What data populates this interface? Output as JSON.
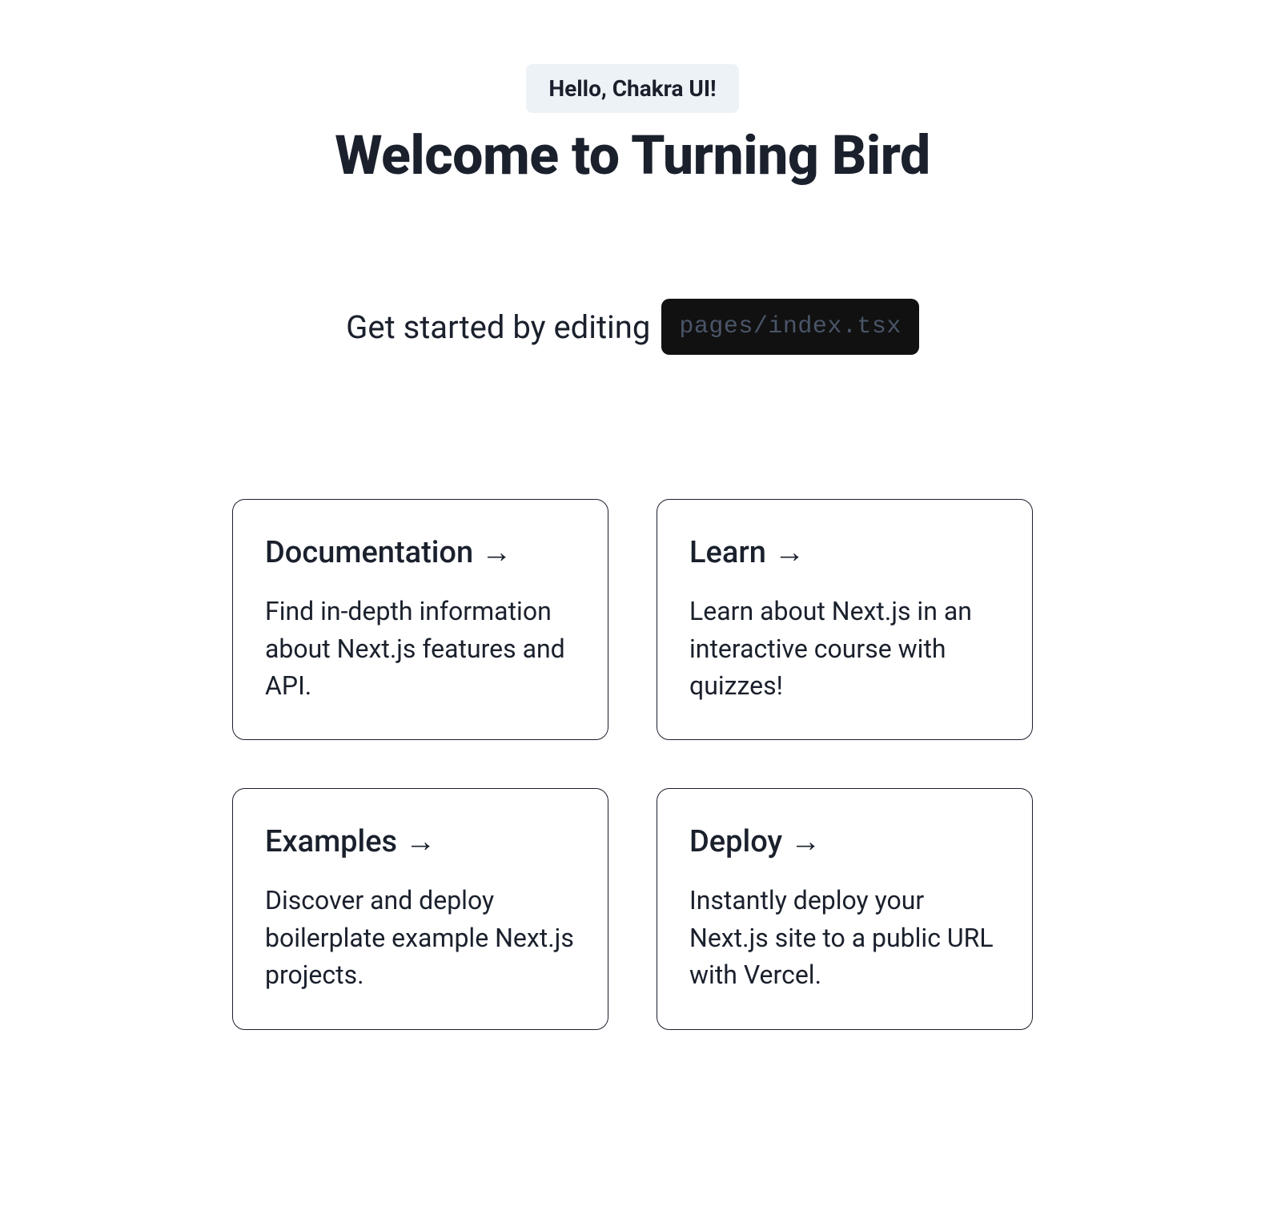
{
  "header": {
    "badge": "Hello, Chakra UI!",
    "title": "Welcome to Turning Bird"
  },
  "subtitle": {
    "prefix": "Get started by editing",
    "code": "pages/index.tsx"
  },
  "arrow_glyph": "→",
  "cards": [
    {
      "title": "Documentation",
      "desc": "Find in-depth information about Next.js features and API."
    },
    {
      "title": "Learn",
      "desc": "Learn about Next.js in an interactive course with quizzes!"
    },
    {
      "title": "Examples",
      "desc": "Discover and deploy boilerplate example Next.js projects."
    },
    {
      "title": "Deploy",
      "desc": "Instantly deploy your Next.js site to a public URL with Vercel."
    }
  ]
}
